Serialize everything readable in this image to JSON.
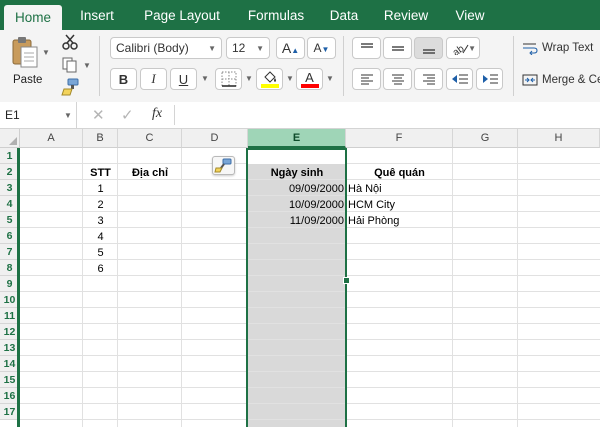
{
  "ribbon_tabs": [
    {
      "label": "Home",
      "active": true
    },
    {
      "label": "Insert",
      "active": false
    },
    {
      "label": "Page Layout",
      "active": false
    },
    {
      "label": "Formulas",
      "active": false
    },
    {
      "label": "Data",
      "active": false
    },
    {
      "label": "Review",
      "active": false
    },
    {
      "label": "View",
      "active": false
    }
  ],
  "clipboard": {
    "paste_label": "Paste"
  },
  "font": {
    "name": "Calibri (Body)",
    "size": "12",
    "bold": "B",
    "italic": "I",
    "underline": "U"
  },
  "alignment": {
    "wrap_text": "Wrap Text",
    "merge": "Merge & Center"
  },
  "formula_bar": {
    "name_box": "E1",
    "fx": "fx",
    "value": ""
  },
  "colors": {
    "brand": "#1e7145",
    "selected_col_bg": "#d9d9d9",
    "fill_color": "#ffff00",
    "font_color": "#ff0000"
  },
  "columns": [
    "A",
    "B",
    "C",
    "D",
    "E",
    "F",
    "G",
    "H"
  ],
  "selected_column": "E",
  "rows": [
    "1",
    "2",
    "3",
    "4",
    "5",
    "6",
    "7",
    "8",
    "9",
    "10",
    "11",
    "12",
    "13",
    "14",
    "15",
    "16",
    "17"
  ],
  "cells": {
    "B2": "STT",
    "C2": "Địa chỉ",
    "E2": "Ngày sinh",
    "F2": "Quê quán",
    "B3": "1",
    "B4": "2",
    "B5": "3",
    "B6": "4",
    "B7": "5",
    "B8": "6",
    "E3": "09/09/2000",
    "E4": "10/09/2000",
    "E5": "11/09/2000",
    "F3": "Hà Nội",
    "F4": "HCM City",
    "F5": "Hải Phòng"
  },
  "icons": {
    "paste": "clipboard-icon",
    "cut": "scissors-icon",
    "copy": "copy-icon",
    "format_painter": "paintbrush-icon",
    "increase_font": "increase-font-icon",
    "decrease_font": "decrease-font-icon",
    "borders": "borders-icon",
    "fill_color": "fill-bucket-icon",
    "font_color": "font-color-icon",
    "orientation": "text-orientation-icon",
    "indent": "indent-icon",
    "outdent": "outdent-icon",
    "wrap": "wrap-text-icon",
    "merge": "merge-icon",
    "cancel": "cancel-icon",
    "enter": "checkmark-icon",
    "paste_options": "paste-options-icon"
  }
}
